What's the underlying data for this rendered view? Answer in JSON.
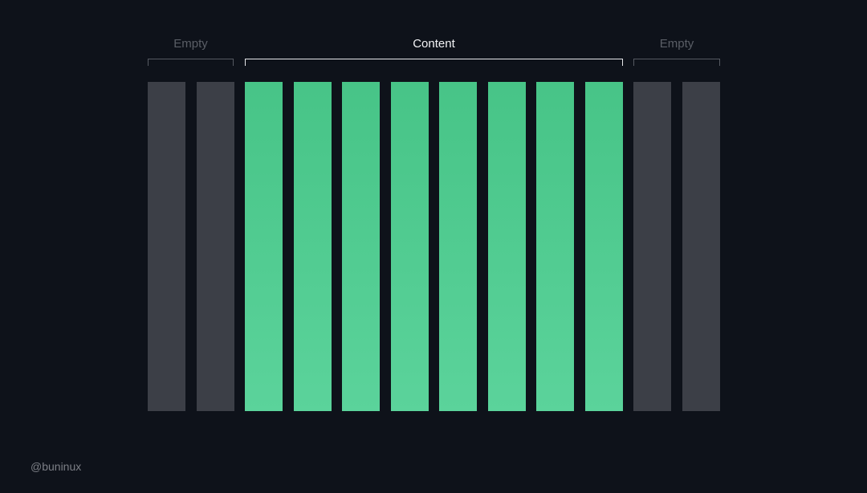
{
  "groups": {
    "left": {
      "label": "Empty"
    },
    "content": {
      "label": "Content"
    },
    "right": {
      "label": "Empty"
    }
  },
  "columns": [
    {
      "kind": "empty"
    },
    {
      "kind": "empty"
    },
    {
      "kind": "content"
    },
    {
      "kind": "content"
    },
    {
      "kind": "content"
    },
    {
      "kind": "content"
    },
    {
      "kind": "content"
    },
    {
      "kind": "content"
    },
    {
      "kind": "content"
    },
    {
      "kind": "content"
    },
    {
      "kind": "empty"
    },
    {
      "kind": "empty"
    }
  ],
  "colors": {
    "background": "#0e121a",
    "empty_column": "#3c3f47",
    "content_column": "#4ccb8d"
  },
  "credit": "@buninux"
}
